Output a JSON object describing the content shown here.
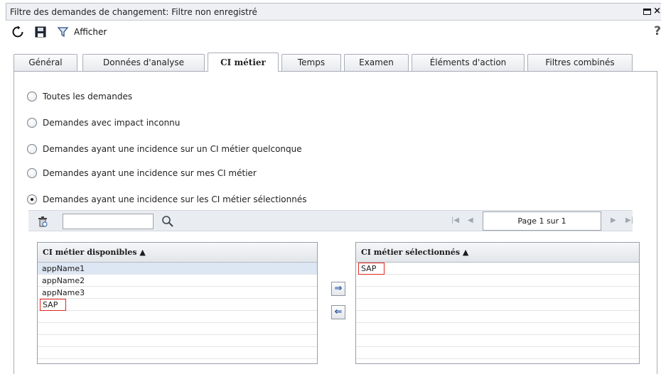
{
  "window": {
    "title": "Filtre des demandes de changement: Filtre non enregistré",
    "close_glyph": "×"
  },
  "toolbar": {
    "refresh_icon": "refresh-icon",
    "save_icon": "save-icon",
    "filter_icon": "filter-icon",
    "show_label": "Afficher",
    "help_label": "?"
  },
  "tabs": [
    {
      "label": "Général",
      "active": false
    },
    {
      "label": "Données d'analyse",
      "active": false
    },
    {
      "label": "CI métier",
      "active": true
    },
    {
      "label": "Temps",
      "active": false
    },
    {
      "label": "Examen",
      "active": false
    },
    {
      "label": "Éléments d'action",
      "active": false
    },
    {
      "label": "Filtres combinés",
      "active": false
    }
  ],
  "radios": [
    {
      "label": "Toutes les demandes",
      "checked": false
    },
    {
      "label": "Demandes avec impact inconnu",
      "checked": false
    },
    {
      "label": "Demandes ayant une incidence sur un CI métier quelconque",
      "checked": false
    },
    {
      "label": "Demandes ayant une incidence sur mes CI métier",
      "checked": false
    },
    {
      "label": "Demandes ayant une incidence sur les CI métier sélectionnés",
      "checked": true
    }
  ],
  "search": {
    "value": "",
    "clear_icon": "clear-filter-icon",
    "search_icon": "search-icon"
  },
  "pagination": {
    "page_text": "Page 1 sur 1"
  },
  "available": {
    "header": "CI métier disponibles ▲",
    "items": [
      "appName1",
      "appName2",
      "appName3",
      "SAP"
    ]
  },
  "selected": {
    "header": "CI métier sélectionnés ▲",
    "items": [
      "SAP"
    ]
  },
  "move": {
    "add_glyph": "⇒",
    "remove_glyph": "⇐"
  },
  "colors": {
    "highlight_border": "#e0281f",
    "selected_row": "#dde6f3",
    "arrow_color": "#1d4f9a"
  }
}
